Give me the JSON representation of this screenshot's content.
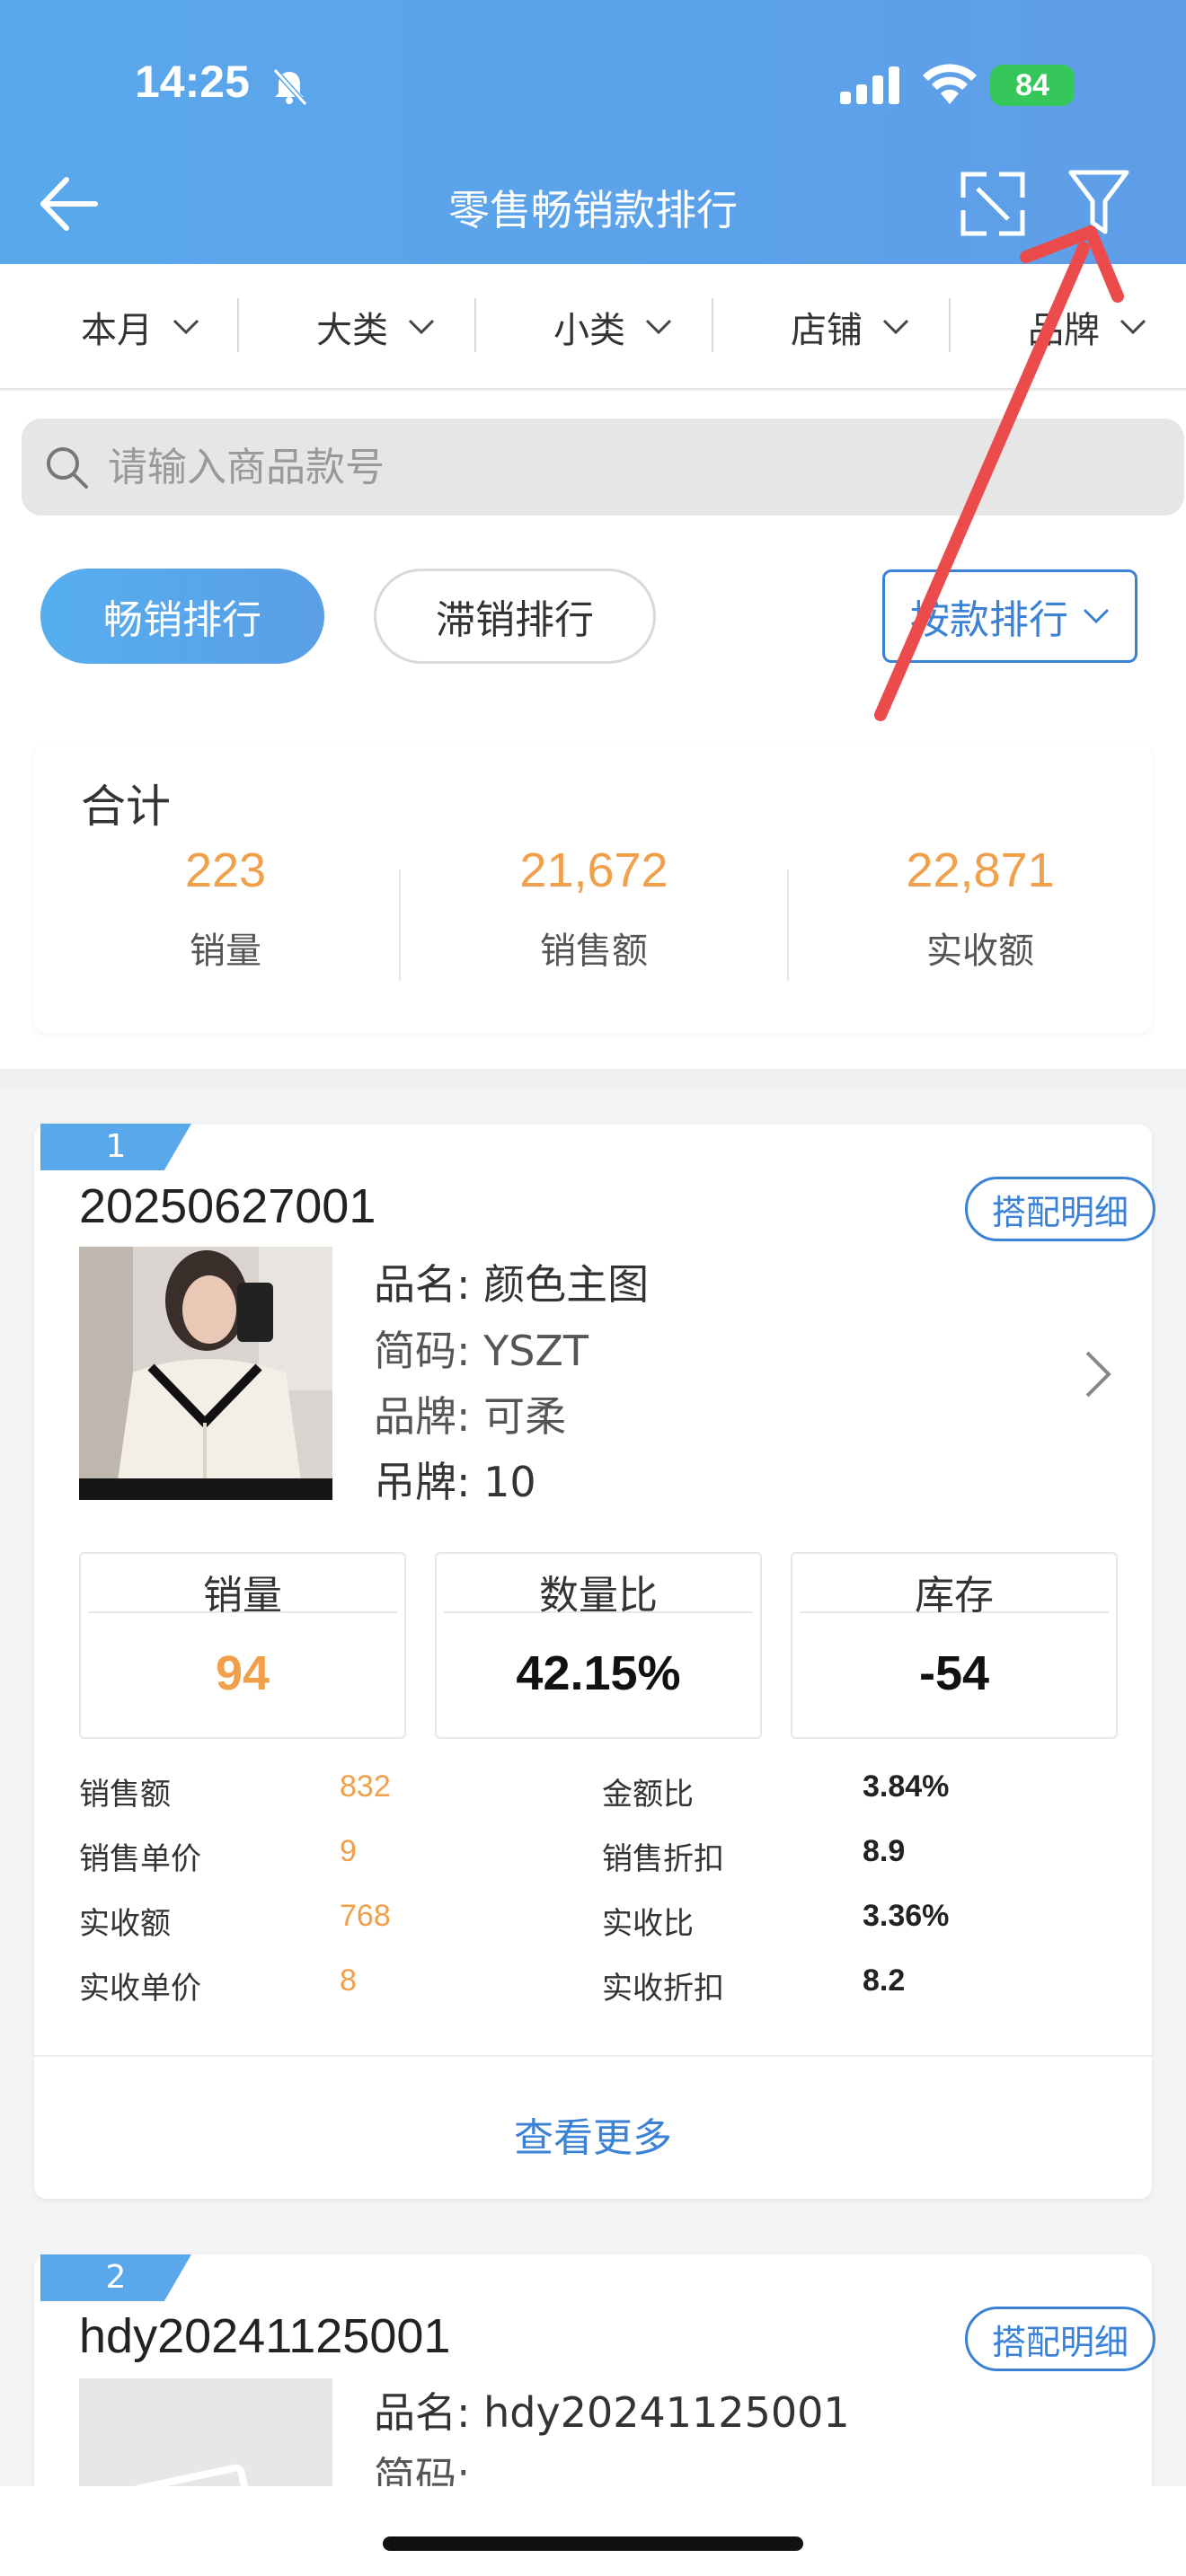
{
  "status_bar": {
    "time": "14:25",
    "battery": "84"
  },
  "header": {
    "title": "零售畅销款排行"
  },
  "filters": [
    {
      "label": "本月"
    },
    {
      "label": "大类"
    },
    {
      "label": "小类"
    },
    {
      "label": "店铺"
    },
    {
      "label": "品牌"
    }
  ],
  "search": {
    "placeholder": "请输入商品款号"
  },
  "tabs": {
    "hot": "畅销排行",
    "slow": "滞销排行"
  },
  "sort": {
    "label": "按款排行"
  },
  "summary": {
    "title": "合计",
    "items": [
      {
        "value": "223",
        "label": "销量"
      },
      {
        "value": "21,672",
        "label": "销售额"
      },
      {
        "value": "22,871",
        "label": "实收额"
      }
    ]
  },
  "products": [
    {
      "rank": "1",
      "code": "20250627001",
      "collocation_label": "搭配明细",
      "info": [
        {
          "key": "品名:",
          "value": "颜色主图"
        },
        {
          "key": "简码:",
          "value": "YSZT"
        },
        {
          "key": "品牌:",
          "value": "可柔"
        },
        {
          "key": "吊牌:",
          "value": "10"
        }
      ],
      "stats": [
        {
          "label": "销量",
          "value": "94"
        },
        {
          "label": "数量比",
          "value": "42.15%"
        },
        {
          "label": "库存",
          "value": "-54"
        }
      ],
      "details_left": [
        {
          "label": "销售额",
          "value": "832"
        },
        {
          "label": "销售单价",
          "value": "9"
        },
        {
          "label": "实收额",
          "value": "768"
        },
        {
          "label": "实收单价",
          "value": "8"
        }
      ],
      "details_right": [
        {
          "label": "金额比",
          "value": "3.84%"
        },
        {
          "label": "销售折扣",
          "value": "8.9"
        },
        {
          "label": "实收比",
          "value": "3.36%"
        },
        {
          "label": "实收折扣",
          "value": "8.2"
        }
      ],
      "view_more": "查看更多"
    },
    {
      "rank": "2",
      "code": "hdy20241125001",
      "collocation_label": "搭配明细",
      "info": [
        {
          "key": "品名:",
          "value": "hdy20241125001"
        },
        {
          "key": "简码:",
          "value": ""
        }
      ]
    }
  ],
  "colors": {
    "primary": "#3b82d6",
    "header": "#5aa8ec",
    "orange": "#f0a04b",
    "annotation": "#ec4b4b"
  }
}
